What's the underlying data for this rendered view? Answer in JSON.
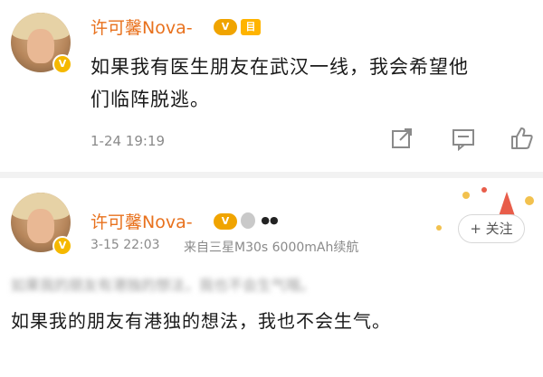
{
  "posts": [
    {
      "username": "许可馨Nova-",
      "text_line1": "如果我有医生朋友在武汉一线，我会希望他",
      "text_line2": "们临阵脱逃。",
      "timestamp": "1-24 19:19",
      "badges": [
        "vip-icon",
        "level-icon"
      ]
    },
    {
      "username": "许可馨Nova-",
      "timestamp": "3-15 22:03",
      "source": "来自三星M30s 6000mAh续航",
      "blurred_text": "如果我的朋友有港独的想法，我也不会生气哦。",
      "text": "如果我的朋友有港独的想法，我也不会生气。",
      "follow_label": "+ 关注",
      "badges": [
        "vip-icon",
        "medal-icon",
        "panda-icon"
      ]
    }
  ],
  "colors": {
    "username": "#e8711d",
    "verify": "#f5b800",
    "meta": "#8a8a8a",
    "text": "#1a1a1a"
  }
}
